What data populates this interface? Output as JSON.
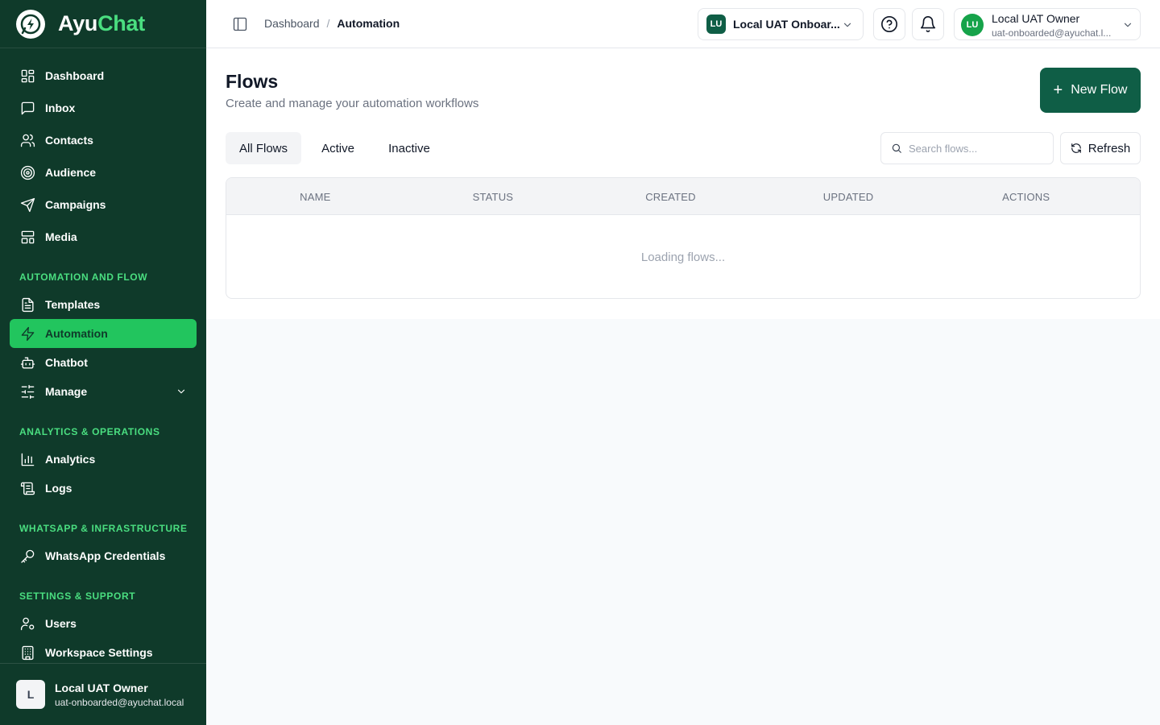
{
  "brand": {
    "part1": "Ayu",
    "part2": "Chat"
  },
  "sidebar": {
    "items": [
      {
        "label": "Dashboard",
        "icon": "dashboard-icon"
      },
      {
        "label": "Inbox",
        "icon": "inbox-icon"
      },
      {
        "label": "Contacts",
        "icon": "contacts-icon"
      },
      {
        "label": "Audience",
        "icon": "target-icon"
      },
      {
        "label": "Campaigns",
        "icon": "send-icon"
      },
      {
        "label": "Media",
        "icon": "media-icon"
      },
      {
        "label": "Templates",
        "icon": "file-text-icon"
      },
      {
        "label": "Automation",
        "icon": "zap-icon",
        "active": true
      },
      {
        "label": "Chatbot",
        "icon": "bot-icon"
      },
      {
        "label": "Manage",
        "icon": "sliders-icon"
      },
      {
        "label": "Analytics",
        "icon": "bar-chart-icon"
      },
      {
        "label": "Logs",
        "icon": "scroll-icon"
      },
      {
        "label": "WhatsApp Credentials",
        "icon": "key-icon"
      },
      {
        "label": "Users",
        "icon": "user-cog-icon"
      },
      {
        "label": "Workspace Settings",
        "icon": "building-icon"
      }
    ],
    "sections": [
      "AUTOMATION AND FLOW",
      "ANALYTICS & OPERATIONS",
      "WHATSAPP & INFRASTRUCTURE",
      "SETTINGS & SUPPORT"
    ],
    "footer_user": {
      "initial": "L",
      "name": "Local UAT Owner",
      "email": "uat-onboarded@ayuchat.local"
    }
  },
  "header": {
    "breadcrumb": [
      "Dashboard",
      "Automation"
    ],
    "breadcrumb_sep": "/",
    "workspace": {
      "badge": "LU",
      "name": "Local UAT Onboar..."
    },
    "user": {
      "badge": "LU",
      "name": "Local UAT Owner",
      "email": "uat-onboarded@ayuchat.l..."
    }
  },
  "main": {
    "title": "Flows",
    "subtitle": "Create and manage your automation workflows",
    "new_button": "New Flow",
    "new_button_icon": "+",
    "tabs": [
      {
        "label": "All Flows",
        "active": true
      },
      {
        "label": "Active"
      },
      {
        "label": "Inactive"
      }
    ],
    "search_placeholder": "Search flows...",
    "refresh_label": "Refresh",
    "columns": [
      "NAME",
      "STATUS",
      "CREATED",
      "UPDATED",
      "ACTIONS"
    ],
    "loading_text": "Loading flows..."
  },
  "colors": {
    "sidebar_bg": "#0f3a2a",
    "accent_green": "#22c55e",
    "section_label": "#4ade80",
    "primary_button": "#0f5e46"
  }
}
